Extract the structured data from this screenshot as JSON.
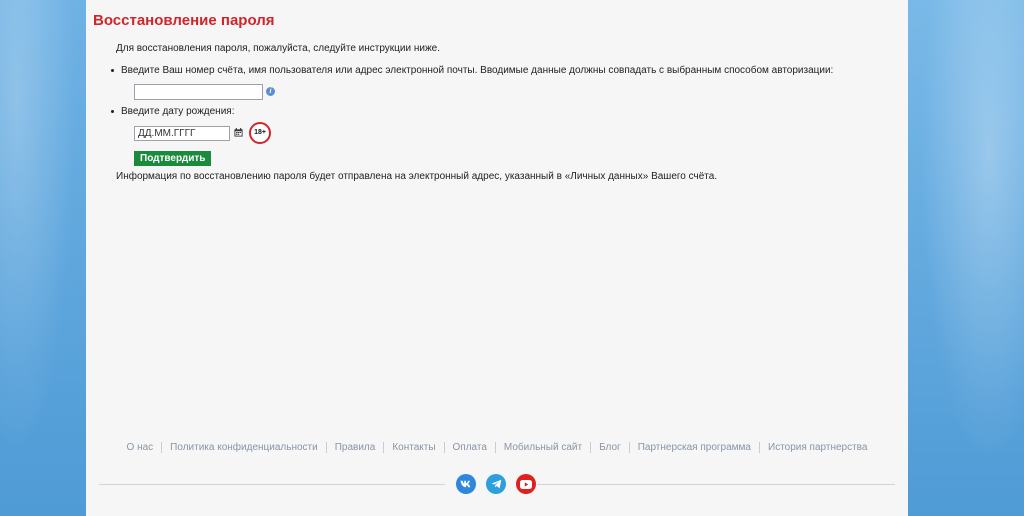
{
  "page": {
    "title": "Восстановление пароля",
    "intro": "Для восстановления пароля, пожалуйста, следуйте инструкции ниже.",
    "step1_label": "Введите Ваш номер счёта, имя пользователя или адрес электронной почты. Вводимые данные должны совпадать с выбранным способом авторизации:",
    "login_value": "",
    "step2_label": "Введите дату рождения:",
    "date_placeholder": "ДД.ММ.ГГГГ",
    "age_badge": "18+",
    "submit_label": "Подтвердить",
    "note": "Информация по восстановлению пароля будет отправлена на электронный адрес, указанный в «Личных данных» Вашего счёта."
  },
  "footer": {
    "links": [
      "О нас",
      "Политика конфиденциальности",
      "Правила",
      "Контакты",
      "Оплата",
      "Мобильный сайт",
      "Блог",
      "Партнерская программа",
      "История партнерства"
    ]
  },
  "social": {
    "vk": "vk-icon",
    "telegram": "telegram-icon",
    "youtube": "youtube-icon"
  },
  "colors": {
    "title": "#d0262b",
    "submit": "#1a8a3c",
    "footer_link": "#8895a4"
  }
}
